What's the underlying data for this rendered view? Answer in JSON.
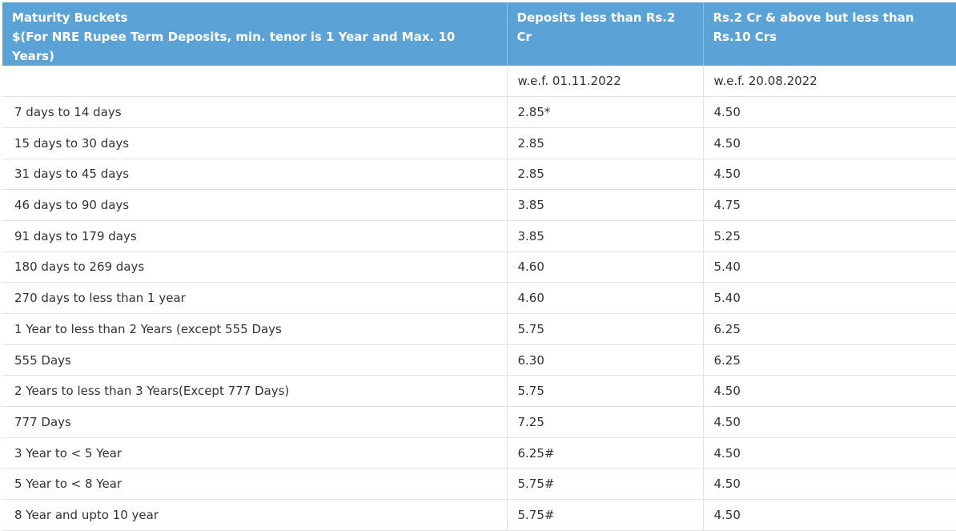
{
  "header": {
    "col1_line1": "Maturity Buckets",
    "col1_line2": "$(For NRE Rupee Term Deposits, min. tenor is 1 Year and Max. 10 Years)",
    "col2": "Deposits less than Rs.2 Cr",
    "col3": "Rs.2 Cr & above but less than Rs.10 Crs"
  },
  "wef_row": {
    "col1": "",
    "col2": "w.e.f. 01.11.2022",
    "col3": "w.e.f. 20.08.2022"
  },
  "rows": [
    {
      "bucket": "7 days to 14 days",
      "rate_lt2cr": "2.85*",
      "rate_2to10cr": "4.50"
    },
    {
      "bucket": "15 days to 30 days",
      "rate_lt2cr": "2.85",
      "rate_2to10cr": "4.50"
    },
    {
      "bucket": "31 days to 45 days",
      "rate_lt2cr": "2.85",
      "rate_2to10cr": "4.50"
    },
    {
      "bucket": "46 days to 90 days",
      "rate_lt2cr": "3.85",
      "rate_2to10cr": "4.75"
    },
    {
      "bucket": "91 days to 179 days",
      "rate_lt2cr": "3.85",
      "rate_2to10cr": "5.25"
    },
    {
      "bucket": "180 days to 269 days",
      "rate_lt2cr": "4.60",
      "rate_2to10cr": "5.40"
    },
    {
      "bucket": "270 days to less than 1 year",
      "rate_lt2cr": "4.60",
      "rate_2to10cr": "5.40"
    },
    {
      "bucket": "1 Year to less than 2 Years (except 555 Days",
      "rate_lt2cr": "5.75",
      "rate_2to10cr": "6.25"
    },
    {
      "bucket": "555 Days",
      "rate_lt2cr": "6.30",
      "rate_2to10cr": "6.25"
    },
    {
      "bucket": "2 Years to less than 3 Years(Except 777 Days)",
      "rate_lt2cr": "5.75",
      "rate_2to10cr": "4.50"
    },
    {
      "bucket": "777 Days",
      "rate_lt2cr": "7.25",
      "rate_2to10cr": "4.50"
    },
    {
      "bucket": "3 Year to < 5 Year",
      "rate_lt2cr": "6.25#",
      "rate_2to10cr": "4.50"
    },
    {
      "bucket": "5 Year to < 8 Year",
      "rate_lt2cr": "5.75#",
      "rate_2to10cr": "4.50"
    },
    {
      "bucket": "8 Year and upto 10 year",
      "rate_lt2cr": "5.75#",
      "rate_2to10cr": "4.50"
    }
  ],
  "colors": {
    "header_bg": "#5ba3d6",
    "header_text": "#ffffff",
    "body_text": "#333333",
    "grid_line": "#e3e3e3"
  }
}
